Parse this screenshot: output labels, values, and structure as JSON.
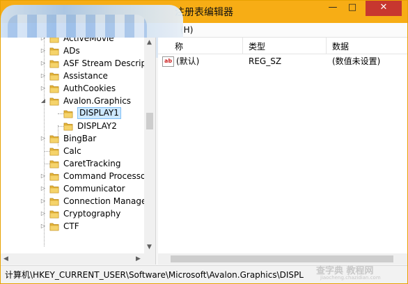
{
  "window": {
    "title": "注册表编辑器",
    "minimize": "—",
    "maximize": "□",
    "close": "✕"
  },
  "menu": {
    "help": "(H)"
  },
  "tree": {
    "items": [
      {
        "label": "ActiveMovie",
        "expander": "▷"
      },
      {
        "label": "ADs",
        "expander": "▷"
      },
      {
        "label": "ASF Stream Descrip",
        "expander": "▷"
      },
      {
        "label": "Assistance",
        "expander": "▷"
      },
      {
        "label": "AuthCookies",
        "expander": "▷"
      },
      {
        "label": "Avalon.Graphics",
        "expander": "◢"
      },
      {
        "label": "DISPLAY1",
        "expander": ""
      },
      {
        "label": "DISPLAY2",
        "expander": ""
      },
      {
        "label": "BingBar",
        "expander": "▷"
      },
      {
        "label": "Calc",
        "expander": ""
      },
      {
        "label": "CaretTracking",
        "expander": ""
      },
      {
        "label": "Command Processo",
        "expander": "▷"
      },
      {
        "label": "Communicator",
        "expander": "▷"
      },
      {
        "label": "Connection Manage",
        "expander": "▷"
      },
      {
        "label": "Cryptography",
        "expander": "▷"
      },
      {
        "label": "CTF",
        "expander": "▷"
      }
    ],
    "selected": "DISPLAY1"
  },
  "columns": {
    "name": "称",
    "type": "类型",
    "data": "数据"
  },
  "values": [
    {
      "name": "(默认)",
      "type": "REG_SZ",
      "data": "(数值未设置)",
      "icon": "ab"
    }
  ],
  "status": {
    "path": "计算机\\HKEY_CURRENT_USER\\Software\\Microsoft\\Avalon.Graphics\\DISPL"
  },
  "scroll": {
    "up": "▲",
    "down": "▼",
    "left": "◀",
    "right": "▶"
  },
  "watermark": {
    "line1": "查字典 教程网",
    "line2": "jiaocheng.chazidian.com"
  },
  "colors": {
    "titlebar": "#f7ad15",
    "close": "#c7372f",
    "selection": "#cde8ff",
    "folder": "#e6b53a"
  }
}
